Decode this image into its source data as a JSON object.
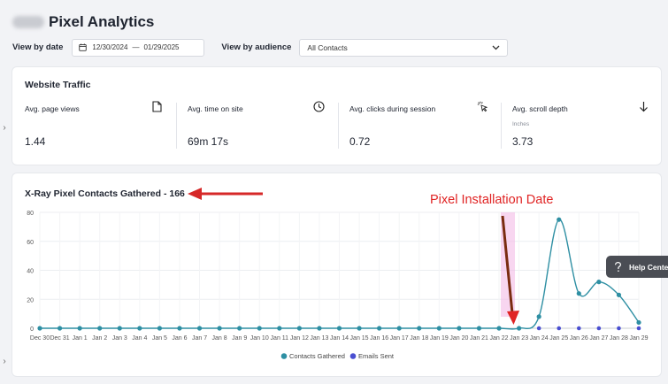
{
  "header": {
    "title": "Pixel Analytics"
  },
  "filters": {
    "date_label": "View by date",
    "date_start": "12/30/2024",
    "date_sep": "—",
    "date_end": "01/29/2025",
    "audience_label": "View by audience",
    "audience_value": "All Contacts"
  },
  "traffic": {
    "title": "Website Traffic",
    "metrics": [
      {
        "label": "Avg. page views",
        "value": "1.44",
        "icon": "document-icon"
      },
      {
        "label": "Avg. time on site",
        "value": "69m 17s",
        "icon": "clock-icon"
      },
      {
        "label": "Avg. clicks during session",
        "value": "0.72",
        "icon": "cursor-click-icon"
      },
      {
        "label": "Avg. scroll depth",
        "sub": "Inches",
        "value": "3.73",
        "icon": "arrow-down-icon"
      }
    ]
  },
  "contacts": {
    "title": "X-Ray Pixel Contacts Gathered - 166"
  },
  "annotation": {
    "text": "Pixel Installation Date"
  },
  "help": {
    "label": "Help Center"
  },
  "colors": {
    "contacts": "#2e8fa3",
    "emails": "#4a4fd1",
    "annotation": "#e02424"
  },
  "chart_data": {
    "type": "line",
    "x": [
      "Dec 30",
      "Dec 31",
      "Jan 1",
      "Jan 2",
      "Jan 3",
      "Jan 4",
      "Jan 5",
      "Jan 6",
      "Jan 7",
      "Jan 8",
      "Jan 9",
      "Jan 10",
      "Jan 11",
      "Jan 12",
      "Jan 13",
      "Jan 14",
      "Jan 15",
      "Jan 16",
      "Jan 17",
      "Jan 18",
      "Jan 19",
      "Jan 20",
      "Jan 21",
      "Jan 22",
      "Jan 23",
      "Jan 24",
      "Jan 25",
      "Jan 26",
      "Jan 27",
      "Jan 28",
      "Jan 29"
    ],
    "yticks": [
      0,
      20,
      40,
      60,
      80
    ],
    "ylim": [
      0,
      80
    ],
    "series": [
      {
        "name": "Contacts Gathered",
        "values": [
          0,
          0,
          0,
          0,
          0,
          0,
          0,
          0,
          0,
          0,
          0,
          0,
          0,
          0,
          0,
          0,
          0,
          0,
          0,
          0,
          0,
          0,
          0,
          0,
          0,
          8,
          75,
          24,
          32,
          23,
          4
        ]
      },
      {
        "name": "Emails Sent",
        "values": [
          0,
          0,
          0,
          0,
          0,
          0,
          0,
          0,
          0,
          0,
          0,
          0,
          0,
          0,
          0,
          0,
          0,
          0,
          0,
          0,
          0,
          0,
          0,
          0,
          0,
          0,
          0,
          0,
          0,
          0,
          0
        ]
      }
    ],
    "legend": "bottom",
    "grid": true
  }
}
